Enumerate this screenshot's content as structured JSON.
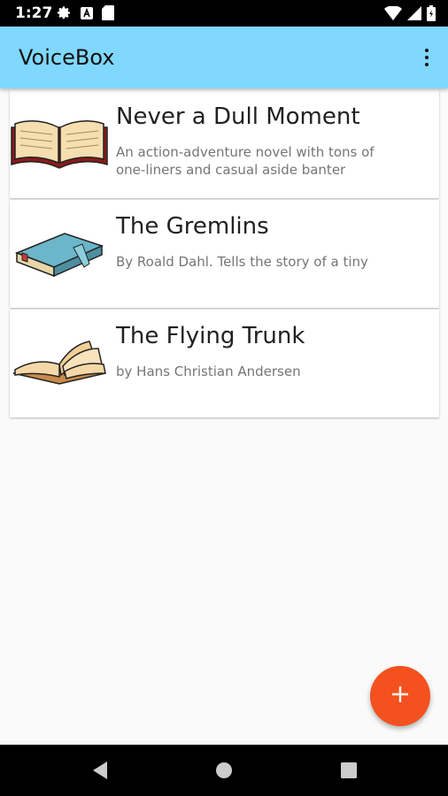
{
  "status_bar": {
    "time": "1:27",
    "left_icons": [
      "settings-icon",
      "a-notification-icon",
      "sd-card-icon"
    ],
    "right_icons": [
      "wifi-icon",
      "signal-icon",
      "battery-icon"
    ]
  },
  "app_bar": {
    "title": "VoiceBox",
    "background": "#80d8ff",
    "overflow_icon": "more-vert-icon"
  },
  "books": [
    {
      "title": "Never a Dull Moment",
      "description": "An action-adventure novel with tons of one-liners and casual aside banter",
      "thumbnail": "open-book-image"
    },
    {
      "title": "The Gremlins",
      "description": "By Roald Dahl.  Tells the story of a tiny",
      "thumbnail": "closed-blue-book-image"
    },
    {
      "title": "The Flying Trunk",
      "description": "by Hans Christian Andersen",
      "thumbnail": "flipping-book-image"
    }
  ],
  "fab": {
    "icon": "add-icon",
    "color": "#f4511e"
  },
  "nav_bar": {
    "buttons": [
      "back-icon",
      "home-icon",
      "recents-icon"
    ]
  }
}
